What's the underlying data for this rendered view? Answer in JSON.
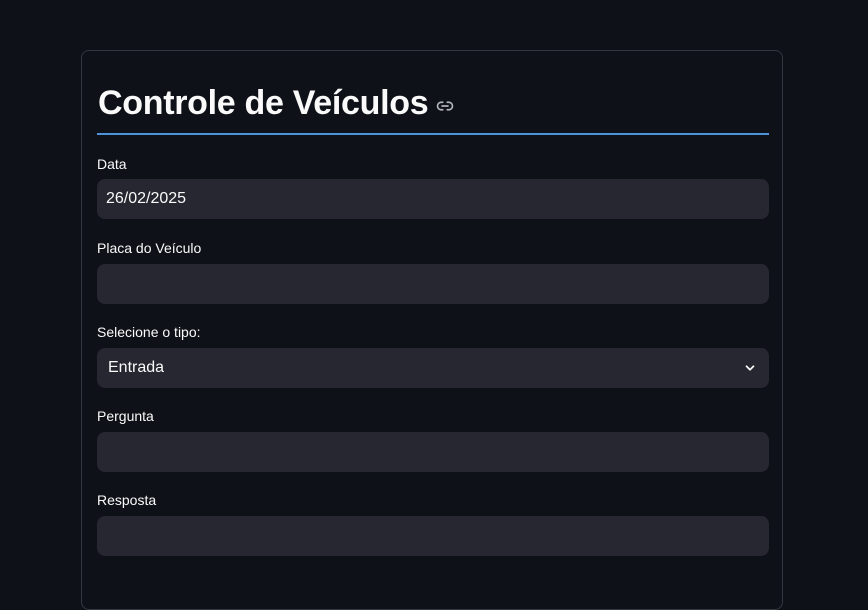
{
  "page": {
    "title": "Controle de Veículos",
    "accent_color": "#4d93d9",
    "background_color": "#0e1117",
    "field_color": "#262730"
  },
  "form": {
    "date": {
      "label": "Data",
      "value": "26/02/2025"
    },
    "plate": {
      "label": "Placa do Veículo",
      "value": "",
      "placeholder": ""
    },
    "type": {
      "label": "Selecione o tipo:",
      "selected": "Entrada"
    },
    "question": {
      "label": "Pergunta",
      "value": "",
      "placeholder": ""
    },
    "answer": {
      "label": "Resposta",
      "value": "",
      "placeholder": ""
    }
  },
  "icons": {
    "title_anchor": "link-icon",
    "select_toggle": "chevron-down-icon"
  }
}
